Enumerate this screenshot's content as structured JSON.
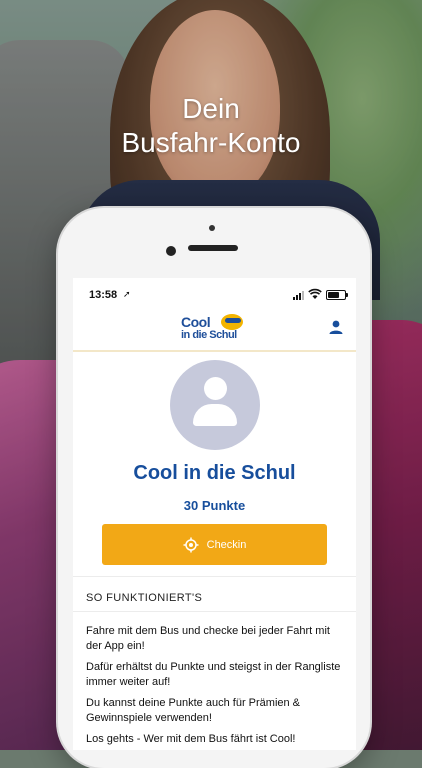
{
  "headline": {
    "line1": "Dein",
    "line2": "Busfahr-Konto"
  },
  "status_bar": {
    "time": "13:58",
    "location_arrow": "➚"
  },
  "app": {
    "logo": {
      "line1": "Cool",
      "line2": "in die Schul"
    }
  },
  "profile": {
    "name": "Cool in die Schul",
    "points": "30 Punkte",
    "checkin_label": "Checkin"
  },
  "info": {
    "title": "SO FUNKTIONIERT'S",
    "paragraphs": [
      "Fahre mit dem Bus und checke bei jeder Fahrt mit der App ein!",
      "Dafür erhältst du Punkte und steigst in der Rangliste immer weiter auf!",
      "Du kannst deine Punkte auch für Prämien & Gewinnspiele verwenden!",
      "Los gehts - Wer mit dem Bus fährt ist Cool!"
    ]
  },
  "colors": {
    "primary_blue": "#174e9c",
    "accent_orange": "#f2a816",
    "avatar_bg": "#c6c9db"
  },
  "icons": {
    "person_button": "person-icon",
    "checkin": "crosshair-icon",
    "avatar": "user-silhouette-icon"
  }
}
